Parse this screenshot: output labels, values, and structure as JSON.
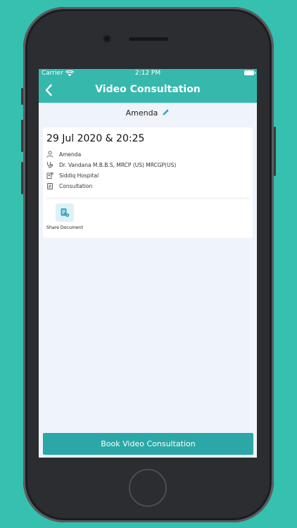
{
  "status_bar": {
    "carrier": "Carrier",
    "time": "2:12 PM"
  },
  "nav": {
    "title": "Video Consultation"
  },
  "patient": {
    "name": "Amenda"
  },
  "appointment": {
    "datetime": "29 Jul 2020 & 20:25",
    "patient_name": "Amenda",
    "doctor": "Dr. Vandana M.B.B.S, MRCP (US) MRCGP(US)",
    "hospital": "Siddiq Hospital",
    "type": "Consultation"
  },
  "actions": {
    "share_document_label": "Share Document"
  },
  "footer": {
    "book_button_label": "Book Video Consultation"
  },
  "colors": {
    "background": "#36c0b0",
    "nav": "#36b8ac",
    "button": "#2ba7a8",
    "screen_bg": "#eff4fb"
  }
}
